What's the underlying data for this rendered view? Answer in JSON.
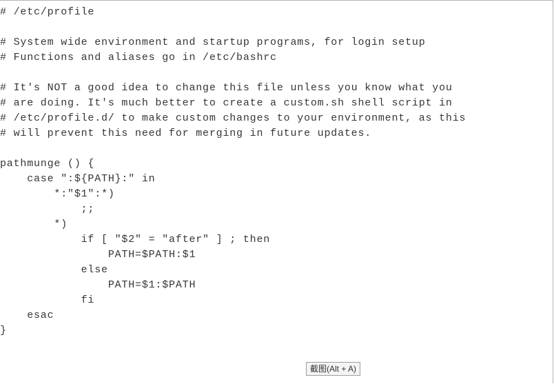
{
  "code": {
    "lines": [
      "# /etc/profile",
      "",
      "# System wide environment and startup programs, for login setup",
      "# Functions and aliases go in /etc/bashrc",
      "",
      "# It's NOT a good idea to change this file unless you know what you",
      "# are doing. It's much better to create a custom.sh shell script in",
      "# /etc/profile.d/ to make custom changes to your environment, as this",
      "# will prevent this need for merging in future updates.",
      "",
      "pathmunge () {",
      "    case \":${PATH}:\" in",
      "        *:\"$1\":*)",
      "            ;;",
      "        *)",
      "            if [ \"$2\" = \"after\" ] ; then",
      "                PATH=$PATH:$1",
      "            else",
      "                PATH=$1:$PATH",
      "            fi",
      "    esac",
      "}"
    ]
  },
  "tooltip": {
    "label": "截图(Alt + A)"
  }
}
